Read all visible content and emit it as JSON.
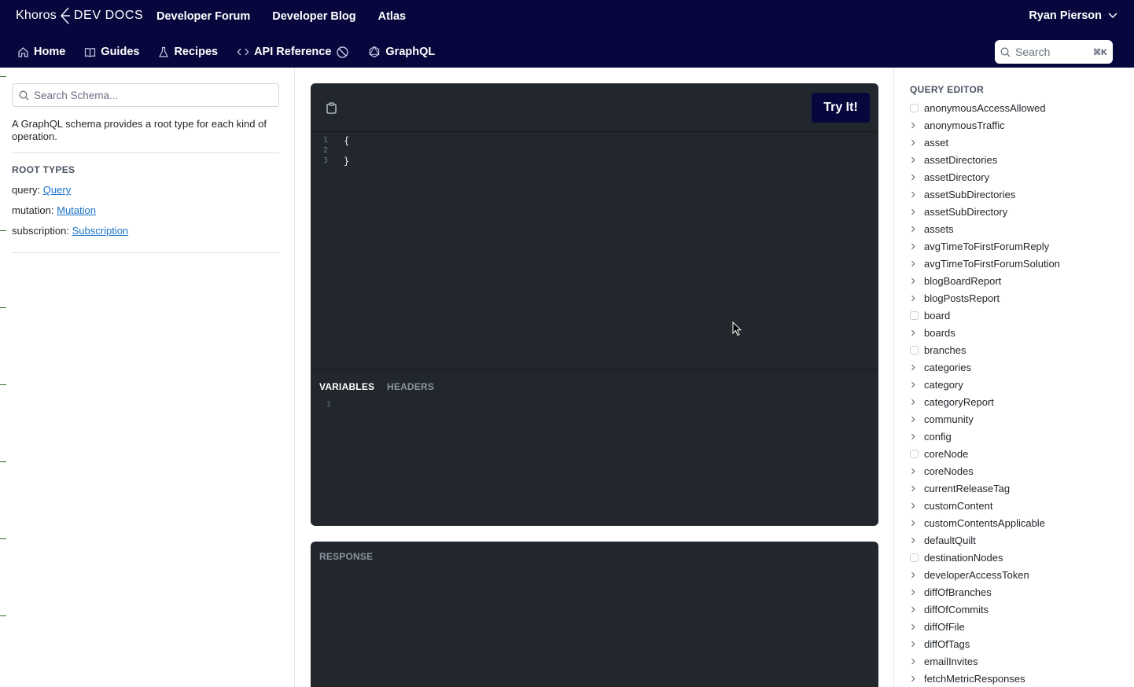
{
  "header": {
    "brand": "Khoros",
    "product": "DEV DOCS",
    "nav": [
      "Developer Forum",
      "Developer Blog",
      "Atlas"
    ],
    "user_name": "Ryan Pierson"
  },
  "subnav": {
    "items": [
      {
        "label": "Home",
        "icon": "home-icon"
      },
      {
        "label": "Guides",
        "icon": "book-icon"
      },
      {
        "label": "Recipes",
        "icon": "flask-icon"
      },
      {
        "label": "API Reference",
        "icon": "code-icon"
      },
      {
        "label": "GraphQL",
        "icon": "graphql-icon"
      }
    ],
    "search_placeholder": "Search",
    "search_shortcut": "⌘K"
  },
  "schema_panel": {
    "search_placeholder": "Search Schema...",
    "description": "A GraphQL schema provides a root type for each kind of operation.",
    "root_types_title": "ROOT TYPES",
    "root_types": [
      {
        "label": "query:",
        "link": "Query"
      },
      {
        "label": "mutation:",
        "link": "Mutation"
      },
      {
        "label": "subscription:",
        "link": "Subscription"
      }
    ]
  },
  "editor": {
    "try_label": "Try It!",
    "lines": [
      {
        "n": "1",
        "text": "{"
      },
      {
        "n": "2",
        "text": ""
      },
      {
        "n": "3",
        "text": "}"
      }
    ],
    "tabs": [
      "VARIABLES",
      "HEADERS"
    ],
    "active_tab": "VARIABLES",
    "variables_line": "1"
  },
  "response": {
    "title": "RESPONSE"
  },
  "query_editor": {
    "title": "QUERY EDITOR",
    "fields": [
      {
        "name": "anonymousAccessAllowed",
        "kind": "checkbox"
      },
      {
        "name": "anonymousTraffic",
        "kind": "expand"
      },
      {
        "name": "asset",
        "kind": "expand"
      },
      {
        "name": "assetDirectories",
        "kind": "expand"
      },
      {
        "name": "assetDirectory",
        "kind": "expand"
      },
      {
        "name": "assetSubDirectories",
        "kind": "expand"
      },
      {
        "name": "assetSubDirectory",
        "kind": "expand"
      },
      {
        "name": "assets",
        "kind": "expand"
      },
      {
        "name": "avgTimeToFirstForumReply",
        "kind": "expand"
      },
      {
        "name": "avgTimeToFirstForumSolution",
        "kind": "expand"
      },
      {
        "name": "blogBoardReport",
        "kind": "expand"
      },
      {
        "name": "blogPostsReport",
        "kind": "expand"
      },
      {
        "name": "board",
        "kind": "checkbox"
      },
      {
        "name": "boards",
        "kind": "expand"
      },
      {
        "name": "branches",
        "kind": "checkbox"
      },
      {
        "name": "categories",
        "kind": "expand"
      },
      {
        "name": "category",
        "kind": "expand"
      },
      {
        "name": "categoryReport",
        "kind": "expand"
      },
      {
        "name": "community",
        "kind": "expand"
      },
      {
        "name": "config",
        "kind": "expand"
      },
      {
        "name": "coreNode",
        "kind": "checkbox"
      },
      {
        "name": "coreNodes",
        "kind": "expand"
      },
      {
        "name": "currentReleaseTag",
        "kind": "expand"
      },
      {
        "name": "customContent",
        "kind": "expand"
      },
      {
        "name": "customContentsApplicable",
        "kind": "expand"
      },
      {
        "name": "defaultQuilt",
        "kind": "expand"
      },
      {
        "name": "destinationNodes",
        "kind": "checkbox"
      },
      {
        "name": "developerAccessToken",
        "kind": "expand"
      },
      {
        "name": "diffOfBranches",
        "kind": "expand"
      },
      {
        "name": "diffOfCommits",
        "kind": "expand"
      },
      {
        "name": "diffOfFile",
        "kind": "expand"
      },
      {
        "name": "diffOfTags",
        "kind": "expand"
      },
      {
        "name": "emailInvites",
        "kind": "expand"
      },
      {
        "name": "fetchMetricResponses",
        "kind": "expand"
      }
    ]
  }
}
